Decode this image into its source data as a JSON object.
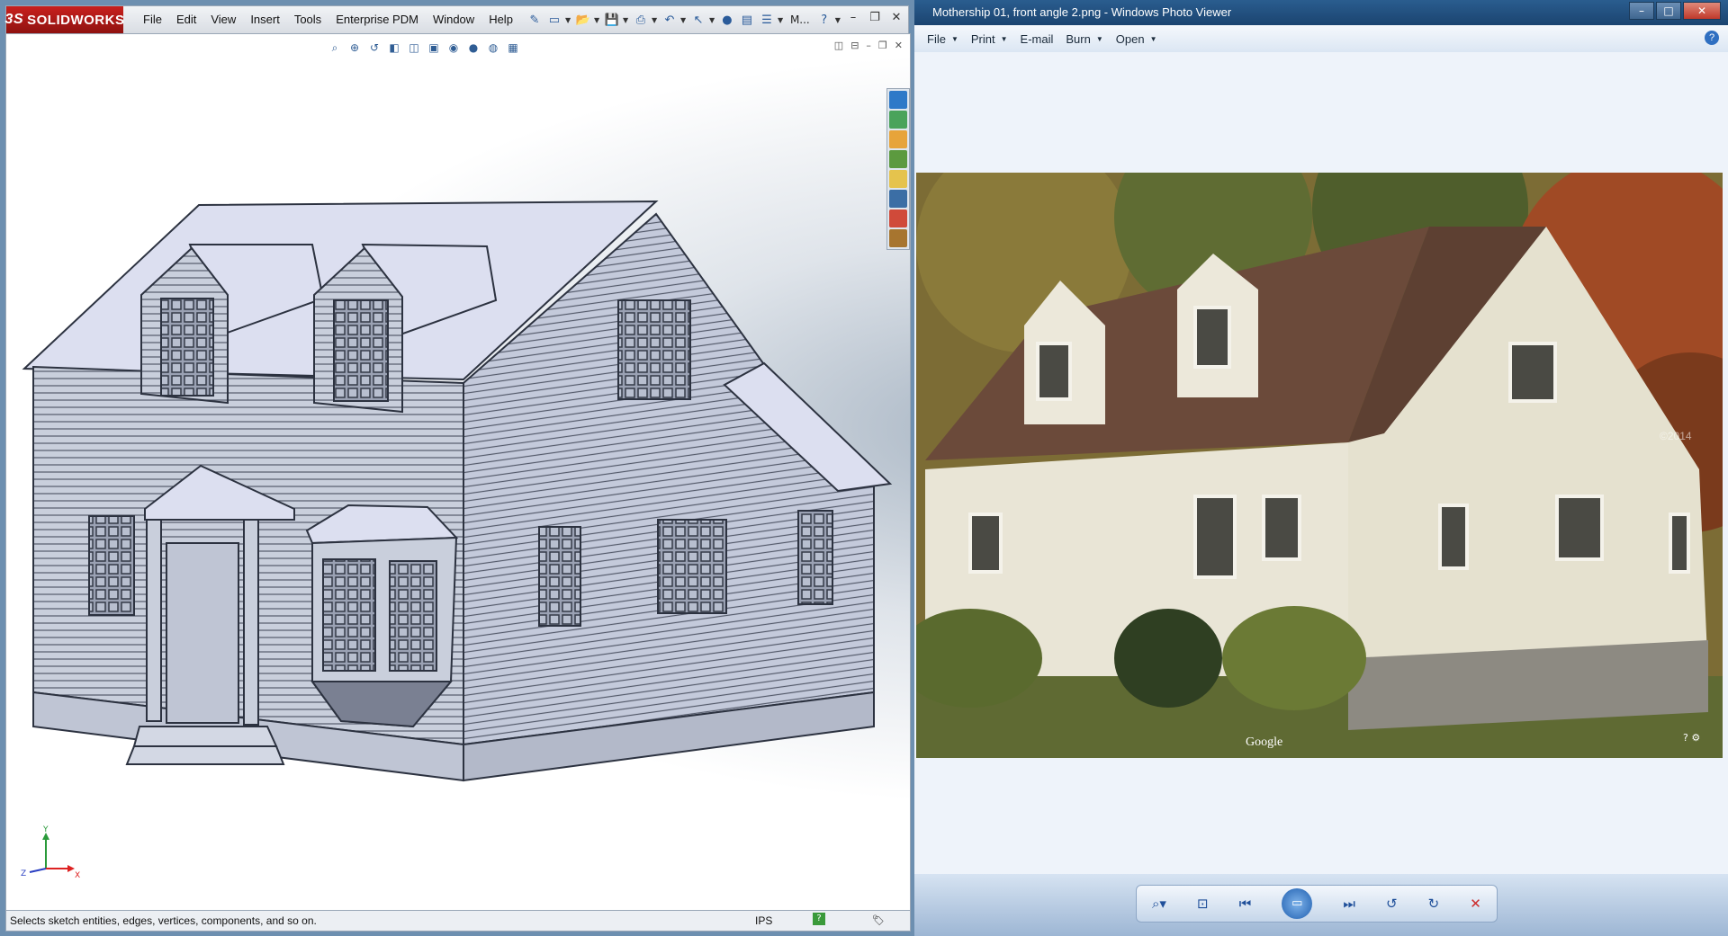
{
  "solidworks": {
    "brand": "SOLIDWORKS",
    "menu": [
      "File",
      "Edit",
      "View",
      "Insert",
      "Tools",
      "Enterprise PDM",
      "Window",
      "Help"
    ],
    "toolbar_overflow": "M...",
    "status": {
      "message": "Selects sketch entities, edges, vertices, components, and so on.",
      "units": "IPS"
    },
    "triad": {
      "x": "X",
      "y": "Y",
      "z": "Z"
    }
  },
  "photo_viewer": {
    "title": "Mothership 01, front angle 2.png - Windows Photo Viewer",
    "menu": [
      "File",
      "Print",
      "E-mail",
      "Burn",
      "Open"
    ],
    "watermark": "Google",
    "watermark_year": "©2014"
  },
  "colors": {
    "sw_red": "#c8201d",
    "model_face": "#c9cfdc",
    "model_roof": "#dcdff0",
    "siding": "#e9e5d6",
    "shingle": "#6b4a3a"
  }
}
